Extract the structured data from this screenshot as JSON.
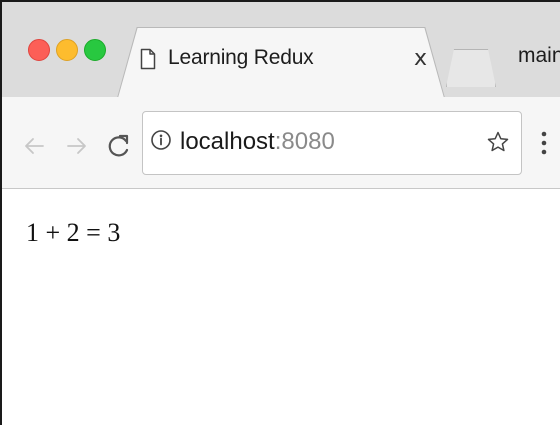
{
  "window": {
    "traffic_lights": [
      "close",
      "minimize",
      "zoom"
    ]
  },
  "tabbar": {
    "active_tab": {
      "title": "Learning Redux",
      "close_label": "x",
      "icon": "page-icon"
    },
    "profile_name": "main"
  },
  "toolbar": {
    "back_icon": "back-arrow-icon",
    "forward_icon": "forward-arrow-icon",
    "reload_icon": "reload-icon",
    "address": {
      "host": "localhost",
      "port": ":8080",
      "icon": "info-icon"
    },
    "bookmark_icon": "star-icon",
    "menu_icon": "kebab-menu-icon"
  },
  "page": {
    "output_text": "1 + 2 = 3"
  },
  "colors": {
    "close": "#fc5f57",
    "minimize": "#fdbc2e",
    "zoom": "#28c840",
    "tabbar_bg": "#dcdcdc",
    "toolbar_bg": "#f6f6f6"
  }
}
